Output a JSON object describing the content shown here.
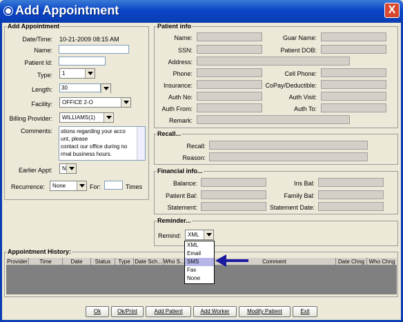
{
  "window": {
    "title": "Add Appointment",
    "close_glyph": "X"
  },
  "add_appointment": {
    "section_title": "Add Appointment",
    "datetime_label": "Date/Time:",
    "datetime_value": "10-21-2009 08:15 AM",
    "name_label": "Name:",
    "patient_id_label": "Patient Id:",
    "type_label": "Type:",
    "type_value": "1",
    "length_label": "Length:",
    "length_value": "30",
    "facility_label": "Facility:",
    "facility_value": "OFFICE 2-O",
    "billing_provider_label": "Billing Provider:",
    "billing_provider_value": "WILLIAMS(1)",
    "comments_label": "Comments:",
    "comments_lines": [
      "stions regarding your acco",
      "unt, please",
      "contact our office during no",
      "rmal business hours."
    ],
    "earlier_appt_label": "Earlier Appt:",
    "earlier_appt_value": "N",
    "recurrence_label": "Recurrence:",
    "recurrence_value": "None",
    "for_label": "For:",
    "times_label": "Times"
  },
  "patient_info": {
    "section_title": "Patient info",
    "name_label": "Name:",
    "guar_name_label": "Guar Name:",
    "ssn_label": "SSN:",
    "patient_dob_label": "Patient DOB:",
    "address_label": "Address:",
    "phone_label": "Phone:",
    "cell_phone_label": "Cell Phone:",
    "insurance_label": "Insurance:",
    "copay_label": "CoPay/Deductible:",
    "auth_no_label": "Auth No:",
    "auth_visit_label": "Auth Visit:",
    "auth_from_label": "Auth From:",
    "auth_to_label": "Auth To:",
    "remark_label": "Remark:"
  },
  "recall": {
    "section_title": "Recall...",
    "recall_label": "Recall:",
    "reason_label": "Reason:"
  },
  "financial": {
    "section_title": "Financial info...",
    "balance_label": "Balance:",
    "ins_bal_label": "Ins Bal:",
    "patient_bal_label": "Patient Bal:",
    "family_bal_label": "Family Bal:",
    "statement_label": "Statement:",
    "statement_date_label": "Statement Date:"
  },
  "reminder": {
    "section_title": "Reminder...",
    "remind_label": "Remind:",
    "remind_value": "XML",
    "options": [
      "XML",
      "Email",
      "SMS",
      "Fax",
      "None"
    ],
    "highlighted_option": "SMS"
  },
  "history": {
    "section_title": "Appointment History:",
    "columns": [
      "Provider",
      "Time",
      "Date",
      "Status",
      "Type",
      "Date Sch...",
      "Who S...",
      "",
      "Comment",
      "Date Chng",
      "Who Chng"
    ]
  },
  "buttons": {
    "ok": "Ok",
    "ok_print": "Ok/Print",
    "add_patient": "Add Patient",
    "add_worker": "Add Worker",
    "modify_patient": "Modify Patient",
    "exit": "Exit"
  },
  "colors": {
    "titlebar": "#0a3db2",
    "arrow": "#1a1aa0",
    "highlight": "#b6b6e8"
  }
}
